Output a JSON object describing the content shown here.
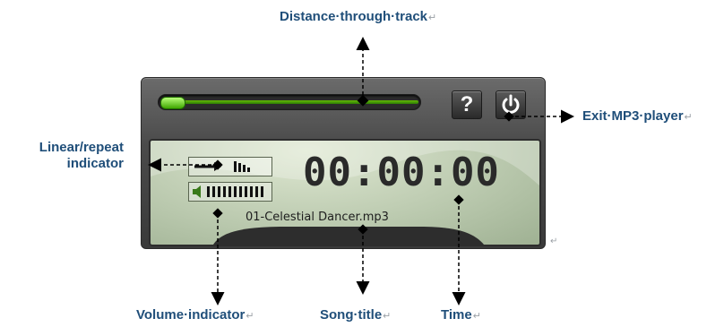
{
  "callouts": {
    "distance": "Distance·through·track",
    "exit": "Exit·MP3·player",
    "linear_line1": "Linear/repeat",
    "linear_line2": "indicator",
    "volume": "Volume·indicator",
    "song": "Song·title",
    "time": "Time"
  },
  "paragraph_mark": "↵",
  "player": {
    "time_display": "00:00:00",
    "song_title": "01-Celestial Dancer.mp3",
    "help_label": "?",
    "progress_fraction": 0.1,
    "volume_level": 1.0,
    "icons": {
      "help": "question-mark-icon",
      "power": "power-icon",
      "mode": "arrow-linear-icon",
      "repeat": "repeat-bars-icon",
      "speaker": "speaker-icon"
    }
  },
  "colors": {
    "label": "#1f4e79",
    "progress_green": "#3fa600",
    "lcd": "#b9c8ad"
  }
}
